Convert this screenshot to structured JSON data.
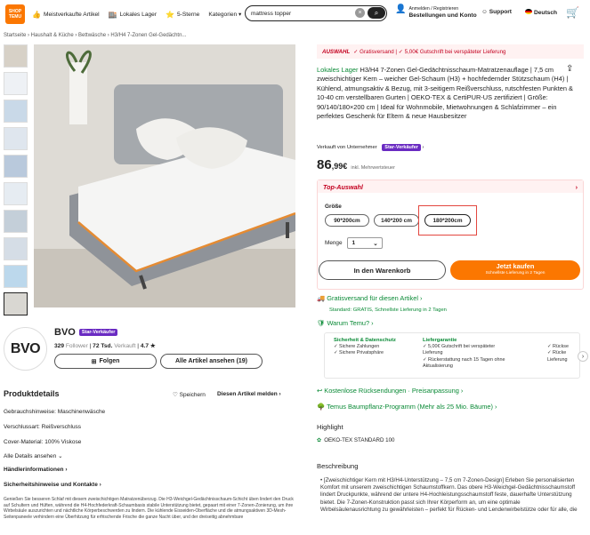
{
  "header": {
    "logo_top": "SHOP",
    "logo_bottom": "TEMU",
    "nav": [
      {
        "icon": "thumb-icon",
        "label": "Meistverkaufte Artikel"
      },
      {
        "icon": "shop-icon",
        "label": "Lokales Lager"
      },
      {
        "icon": "star-icon",
        "label": "5-Sterne"
      },
      {
        "icon": "",
        "label": "Kategorien ▾"
      }
    ],
    "search": "mattress topper",
    "acct_top": "Anmelden / Registrieren",
    "acct_bottom": "Bestellungen und Konto",
    "support": "Support",
    "lang": "Deutsch"
  },
  "breadcrumb": "Startseite › Haushalt & Küche › Bettwäsche › H3/H4 7-Zonen Gel-Gedächtn...",
  "seller": {
    "name": "BVO",
    "badge": "Star-Verkäufer",
    "followers": "329",
    "followers_label": "Follower",
    "sold": "72 Tsd.",
    "sold_label": "Verkauft",
    "rating": "4.7 ★",
    "follow": "Folgen",
    "all": "Alle Artikel ansehen (19)"
  },
  "details": {
    "title": "Produktdetails",
    "save": "Speichern",
    "report": "Diesen Artikel melden ›",
    "rows": [
      "Gebrauchshinweise: Maschinenwäsche",
      "Verschlussart: Reißverschluss",
      "Cover-Material: 100% Viskose",
      "Alle Details ansehen ⌄"
    ],
    "dealer": "Händlerinformationen ›",
    "safety": "Sicherheitshinweise und Kontakte ›",
    "desc": "Genießen Sie besseren Schlaf mit diesem zweischichtigen Matratzenüberzug. Die H3-Weichgel-Gedächtnisschaum-Schicht üben lindert den Druck auf Schultern und Hüften, während die H4-Hochfederkraft-Schaumbasis stabile Unterstützung bietet, gepaart mit einer 7-Zonen-Zonierung, um ihre Wirbelsäule auszurichten und nächtliche Körperbeschwerden zu lindern. Die kühlende Eisseiden-Oberfläche und die atmungsaktiven 3D-Mesh-Seitenpaneele verhindern eine Überhitzung für erfrischende Frische die ganze Nacht über, und der dreiseitig abnehmbare"
  },
  "banner": {
    "a": "AUSWAHL",
    "b": "✓ Gratisversand | ✓ 5,00€ Gutschrift bei verspäteter Lieferung"
  },
  "title": {
    "brand": "Lokales Lager",
    "text": "H3/H4 7-Zonen Gel-Gedächtnisschaum-Matratzenauflage | 7,5 cm zweischichtiger Kern – weicher Gel-Schaum (H3) + hochfedernder Stützschaum (H4) | Kühlend, atmungsaktiv & Bezug, mit 3-seitigem Reißverschluss, rutschfesten Punkten & 10-40 cm verstellbaren Gurten | OEKO-TEX & CertiPUR-US zertifiziert | Größe: 90/140/180×200 cm | Ideal für Wohnmobile, Mietwohnungen & Schlafzimmer – ein perfektes Geschenk für Eltern & neue Hausbesitzer"
  },
  "sold_by": "Verkauft von Unternehmer",
  "price": {
    "main": "86",
    "cents": ",99€",
    "vat": "inkl. Mehrwertsteuer"
  },
  "top": {
    "label": "Top-Auswahl",
    "size_label": "Größe",
    "sizes": [
      "90*200cm",
      "140*200 cm",
      "180*200cm"
    ],
    "qty_label": "Menge",
    "qty": "1"
  },
  "buttons": {
    "cart": "In den Warenkorb",
    "buy": "Jetzt kaufen",
    "buy_sub": "Schnellste Lieferung in 2 Tagen"
  },
  "shipping": {
    "line1": "Gratisversand für diesen Artikel ›",
    "line2": "Standard: GRATIS, Schnellste Lieferung in 2 Tagen"
  },
  "warum": "Warum Temu? ›",
  "warum_cols": {
    "c1_title": "Sicherheit & Datenschutz",
    "c1": [
      "✓ Sichere Zahlungen",
      "✓ Sichere Privatsphäre"
    ],
    "c2_title": "Liefergarantie",
    "c2": [
      "✓ 5,00€ Gutschrift bei verspäteter",
      "Lieferung",
      "✓ Rückerstattung nach 15 Tagen ohne",
      "Aktualisierung"
    ],
    "c3": [
      "✓ Rückse",
      "✓ Rücke",
      "Lieferung"
    ]
  },
  "returns": "Kostenlose Rücksendungen · Preisanpassung ›",
  "plant": "Temus Baumpflanz-Programm (Mehr als 25 Mio. Bäume) ›",
  "highlight": "Highlight",
  "oeko": "OEKO-TEX STANDARD 100",
  "beschreibung": "Beschreibung",
  "btext": "[Zweischichtiger Kern mit H3/H4-Unterstützung – 7,5 cm 7-Zonen-Design] Erleben Sie personalisierten Komfort mit unserem zweischichtigen Schaumstoffkern. Das obere H3-Weichgel-Gedächtnisschaumstoff lindert Druckpunkte, während der untere H4-Hochleistungsschaumstoff feste, dauerhafte Unterstützung bietet. Die 7-Zonen-Konstruktion passt sich Ihrer Körperform an, um eine optimale Wirbelsäulenausrichtung zu gewährleisten – perfekt für Rücken- und Lendenwirbelstütze oder für alle, die"
}
